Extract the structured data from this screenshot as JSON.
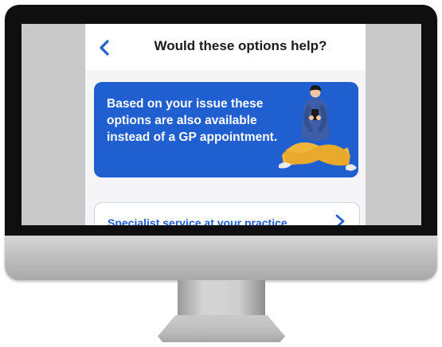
{
  "header": {
    "title": "Would these options help?",
    "back_icon": "chevron-left-icon"
  },
  "info_card": {
    "text": "Based on your issue these options are also available instead of a GP appointment.",
    "background": "#1f5fcf",
    "illustration": "person-sitting-with-phone-illustration"
  },
  "options": [
    {
      "label": "Specialist service at your practice",
      "icon": "chevron-right-icon"
    }
  ],
  "colors": {
    "accent": "#1f5fcf",
    "text_dark": "#1b1b1b",
    "bezel": "#0f0f0f",
    "monitor_frame": "#bcbcbc"
  }
}
